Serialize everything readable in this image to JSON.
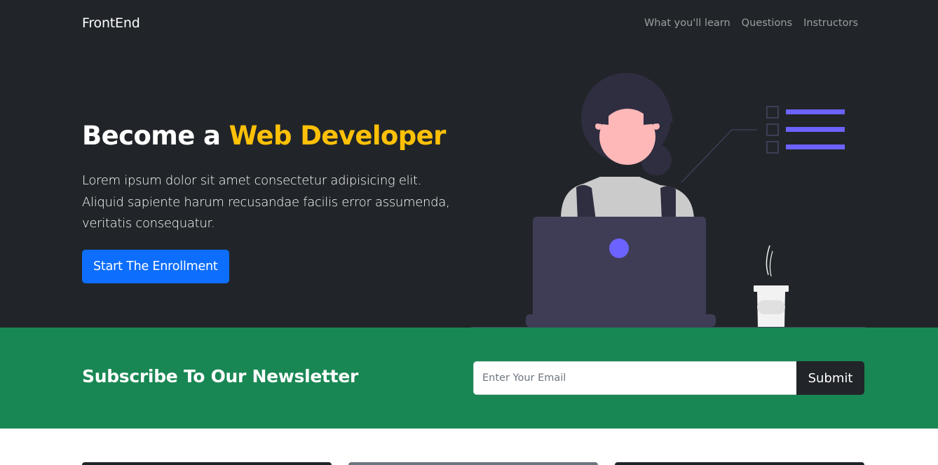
{
  "navbar": {
    "brand": "FrontEnd",
    "links": [
      "What you'll learn",
      "Questions",
      "Instructors"
    ]
  },
  "hero": {
    "title_prefix": "Become a ",
    "title_accent": "Web Developer",
    "lead": "Lorem ipsum dolor sit amet consectetur adipisicing elit. Aliquid sapiente harum recusandae facilis error assumenda, veritatis consequatur.",
    "button_label": "Start The Enrollment"
  },
  "newsletter": {
    "title": "Subscribe To Our Newsletter",
    "email_placeholder": "Enter Your Email",
    "submit_label": "Submit"
  },
  "colors": {
    "dark": "#212529",
    "accent_yellow": "#ffc107",
    "primary_blue": "#0d6efd",
    "success_green": "#198754",
    "illustration_purple": "#6c63ff"
  }
}
